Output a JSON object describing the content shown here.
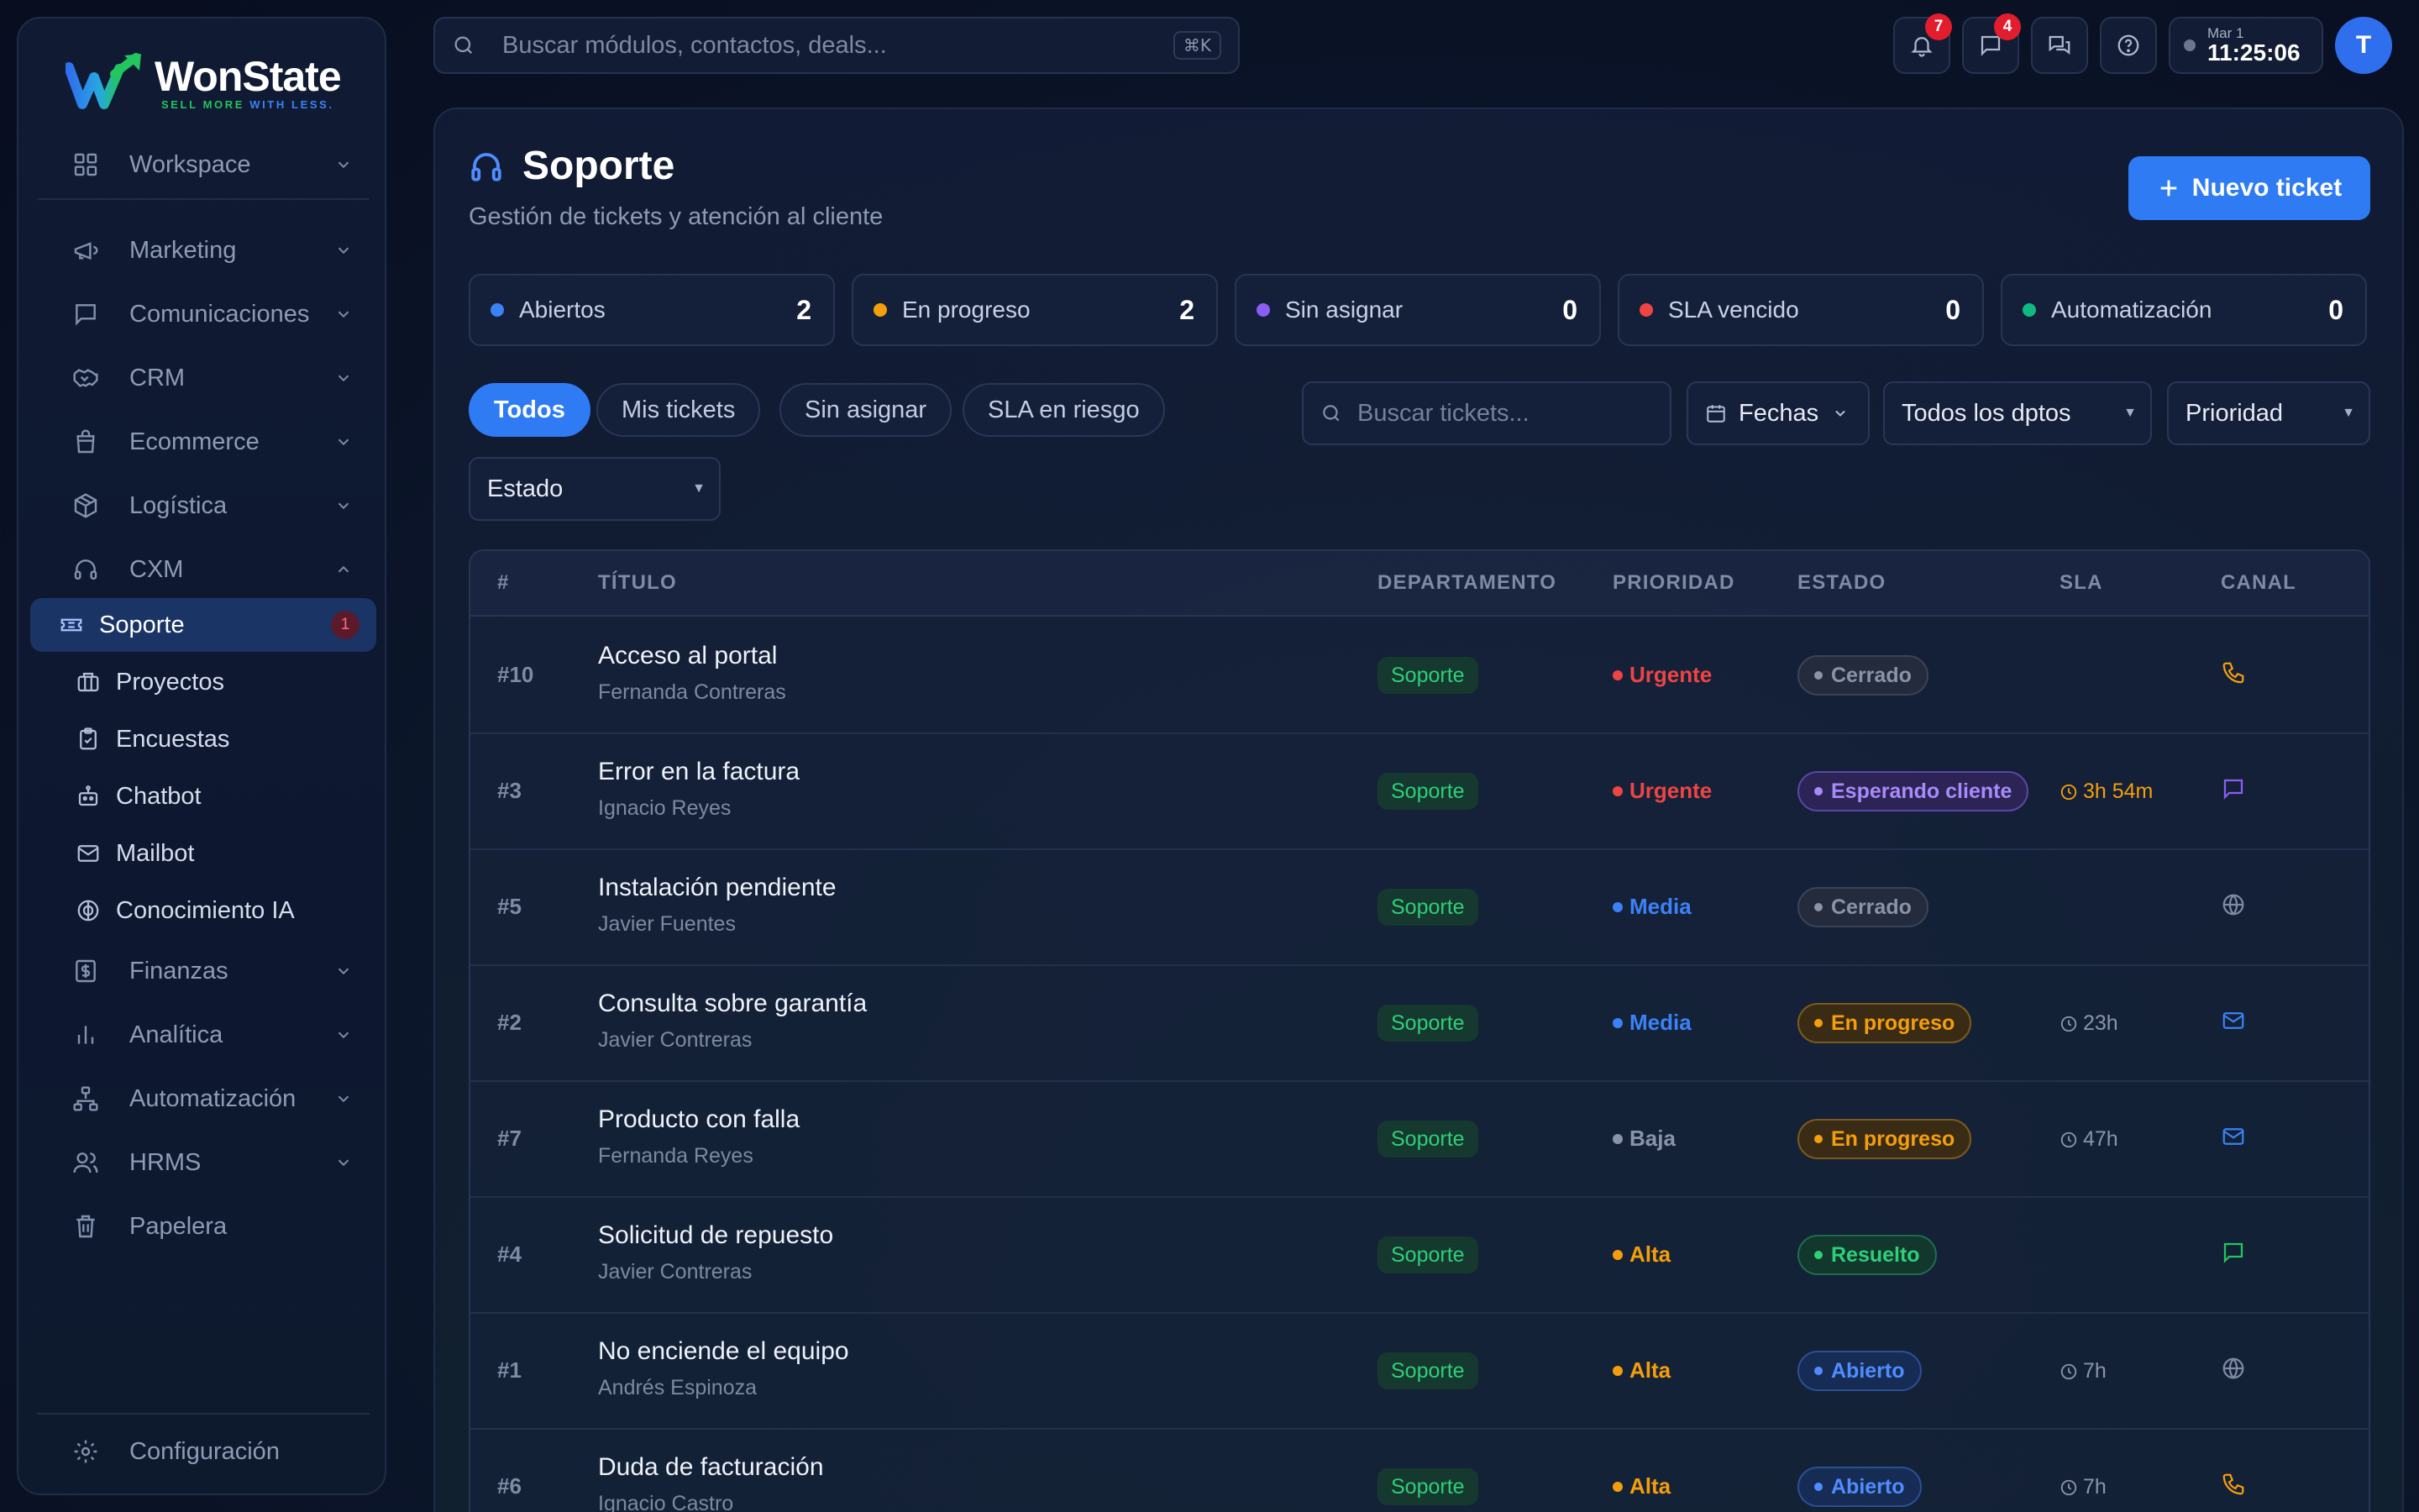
{
  "brand": {
    "name": "WonState",
    "tagline_a": "SELL MORE",
    "tagline_b": " WITH LESS."
  },
  "sidebar": {
    "items": [
      {
        "label": "Workspace",
        "icon": "grid-icon"
      },
      {
        "label": "Marketing",
        "icon": "megaphone-icon"
      },
      {
        "label": "Comunicaciones",
        "icon": "message-icon"
      },
      {
        "label": "CRM",
        "icon": "handshake-icon"
      },
      {
        "label": "Ecommerce",
        "icon": "shopping-bag-icon"
      },
      {
        "label": "Logística",
        "icon": "package-icon"
      },
      {
        "label": "CXM",
        "icon": "headset-icon"
      }
    ],
    "cxm_children": [
      {
        "label": "Soporte",
        "icon": "ticket-icon",
        "badge": "1"
      },
      {
        "label": "Proyectos",
        "icon": "briefcase-icon"
      },
      {
        "label": "Encuestas",
        "icon": "clipboard-icon"
      },
      {
        "label": "Chatbot",
        "icon": "bot-icon"
      },
      {
        "label": "Mailbot",
        "icon": "mail-icon"
      },
      {
        "label": "Conocimiento IA",
        "icon": "brain-icon"
      }
    ],
    "items_after": [
      {
        "label": "Finanzas",
        "icon": "dollar-icon"
      },
      {
        "label": "Analítica",
        "icon": "bar-chart-icon"
      },
      {
        "label": "Automatización",
        "icon": "workflow-icon"
      },
      {
        "label": "HRMS",
        "icon": "users-icon"
      },
      {
        "label": "Papelera",
        "icon": "trash-icon"
      }
    ],
    "settings": "Configuración"
  },
  "topbar": {
    "search_placeholder": "Buscar módulos, contactos, deals...",
    "shortcut": "⌘K",
    "notifications_badge": "7",
    "messages_badge": "4",
    "clock_date": "Mar 1",
    "clock_time": "11:25:06",
    "avatar_initial": "T"
  },
  "page": {
    "title": "Soporte",
    "subtitle": "Gestión de tickets y atención al cliente",
    "new_button": "Nuevo ticket"
  },
  "stats": [
    {
      "label": "Abiertos",
      "value": "2",
      "color": "#3b82f6"
    },
    {
      "label": "En progreso",
      "value": "2",
      "color": "#f59e0b"
    },
    {
      "label": "Sin asignar",
      "value": "0",
      "color": "#8b5cf6"
    },
    {
      "label": "SLA vencido",
      "value": "0",
      "color": "#ef4444"
    },
    {
      "label": "Automatización",
      "value": "0",
      "color": "#10b981"
    }
  ],
  "filters": {
    "chips": [
      "Todos",
      "Mis tickets",
      "Sin asignar",
      "SLA en riesgo"
    ],
    "search_placeholder": "Buscar tickets...",
    "dates": "Fechas",
    "department": "Todos los dptos",
    "priority": "Prioridad",
    "status": "Estado"
  },
  "table": {
    "headers": [
      "#",
      "TÍTULO",
      "DEPARTAMENTO",
      "PRIORIDAD",
      "ESTADO",
      "SLA",
      "CANAL"
    ],
    "rows": [
      {
        "id": "#10",
        "title": "Acceso al portal",
        "customer": "Fernanda Contreras",
        "dept": "Soporte",
        "priority": "Urgente",
        "status": "Cerrado",
        "sla": "",
        "channel": "phone-icon"
      },
      {
        "id": "#3",
        "title": "Error en la factura",
        "customer": "Ignacio Reyes",
        "dept": "Soporte",
        "priority": "Urgente",
        "status": "Esperando cliente",
        "sla": "3h 54m",
        "channel": "chat-icon"
      },
      {
        "id": "#5",
        "title": "Instalación pendiente",
        "customer": "Javier Fuentes",
        "dept": "Soporte",
        "priority": "Media",
        "status": "Cerrado",
        "sla": "",
        "channel": "globe-icon"
      },
      {
        "id": "#2",
        "title": "Consulta sobre garantía",
        "customer": "Javier Contreras",
        "dept": "Soporte",
        "priority": "Media",
        "status": "En progreso",
        "sla": "23h",
        "channel": "mail-icon"
      },
      {
        "id": "#7",
        "title": "Producto con falla",
        "customer": "Fernanda Reyes",
        "dept": "Soporte",
        "priority": "Baja",
        "status": "En progreso",
        "sla": "47h",
        "channel": "mail-icon"
      },
      {
        "id": "#4",
        "title": "Solicitud de repuesto",
        "customer": "Javier Contreras",
        "dept": "Soporte",
        "priority": "Alta",
        "status": "Resuelto",
        "sla": "",
        "channel": "whatsapp-icon"
      },
      {
        "id": "#1",
        "title": "No enciende el equipo",
        "customer": "Andrés Espinoza",
        "dept": "Soporte",
        "priority": "Alta",
        "status": "Abierto",
        "sla": "7h",
        "channel": "globe-icon"
      },
      {
        "id": "#6",
        "title": "Duda de facturación",
        "customer": "Ignacio Castro",
        "dept": "Soporte",
        "priority": "Alta",
        "status": "Abierto",
        "sla": "7h",
        "channel": "phone-icon"
      }
    ]
  },
  "colors": {
    "accent": "#2f7bf3",
    "priority": {
      "Urgente": "#ef4444",
      "Media": "#3b82f6",
      "Baja": "#8a94a8",
      "Alta": "#f59e0b"
    },
    "sla": "#f59e0b"
  }
}
